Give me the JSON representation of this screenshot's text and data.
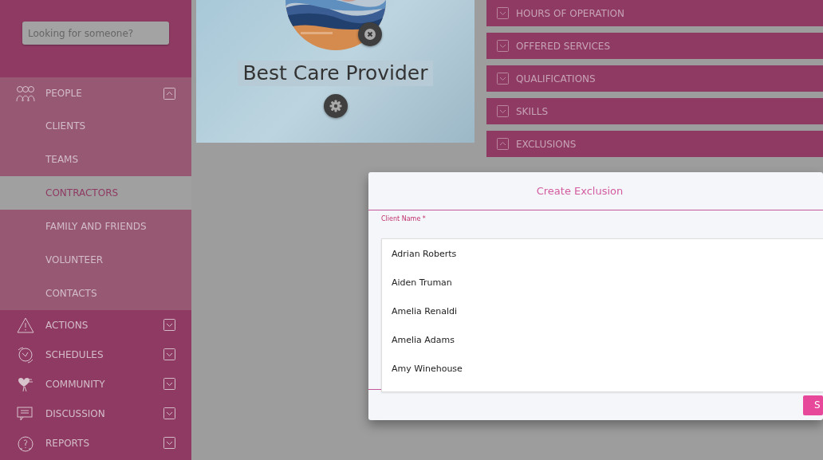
{
  "sidebar": {
    "search": {
      "placeholder": "Looking for someone?"
    },
    "items": [
      {
        "label": "PEOPLE",
        "expanded": true,
        "children": [
          {
            "label": "CLIENTS",
            "selected": false
          },
          {
            "label": "TEAMS",
            "selected": false
          },
          {
            "label": "CONTRACTORS",
            "selected": true
          },
          {
            "label": "FAMILY AND FRIENDS",
            "selected": false
          },
          {
            "label": "VOLUNTEER",
            "selected": false
          },
          {
            "label": "CONTACTS",
            "selected": false
          }
        ]
      },
      {
        "label": "ACTIONS",
        "expanded": false
      },
      {
        "label": "SCHEDULES",
        "expanded": false
      },
      {
        "label": "COMMUNITY",
        "expanded": false
      },
      {
        "label": "DISCUSSION",
        "expanded": false
      },
      {
        "label": "REPORTS",
        "expanded": false
      }
    ]
  },
  "profile": {
    "name": "Best Care Provider"
  },
  "sections": [
    {
      "label": "HOURS OF OPERATION",
      "expanded": false
    },
    {
      "label": "OFFERED SERVICES",
      "expanded": false
    },
    {
      "label": "QUALIFICATIONS",
      "expanded": false
    },
    {
      "label": "SKILLS",
      "expanded": false
    },
    {
      "label": "EXCLUSIONS",
      "expanded": true
    }
  ],
  "modal": {
    "title": "Create Exclusion",
    "field": {
      "label": "Client Name *"
    },
    "options": [
      "Adrian Roberts",
      "Aiden Truman",
      "Amelia Renaldi",
      "Amelia Adams",
      "Amy Winehouse"
    ],
    "button": "S"
  }
}
